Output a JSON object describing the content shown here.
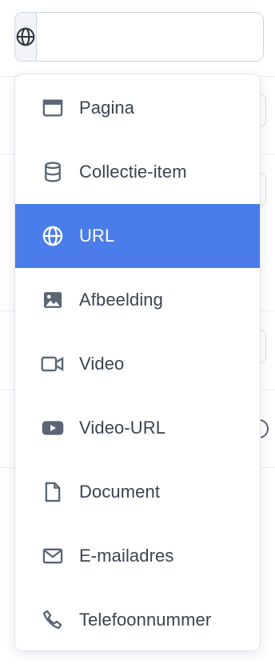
{
  "link_field": {
    "type_button_icon": "globe-icon",
    "url_value": "",
    "url_placeholder": ""
  },
  "menu": {
    "items": [
      {
        "label": "Pagina",
        "icon": "browser-window-icon",
        "active": false
      },
      {
        "label": "Collectie-item",
        "icon": "database-icon",
        "active": false
      },
      {
        "label": "URL",
        "icon": "globe-icon",
        "active": true
      },
      {
        "label": "Afbeelding",
        "icon": "image-icon",
        "active": false
      },
      {
        "label": "Video",
        "icon": "video-camera-icon",
        "active": false
      },
      {
        "label": "Video-URL",
        "icon": "youtube-play-icon",
        "active": false
      },
      {
        "label": "Document",
        "icon": "document-icon",
        "active": false
      },
      {
        "label": "E-mailadres",
        "icon": "envelope-icon",
        "active": false
      },
      {
        "label": "Telefoonnummer",
        "icon": "phone-icon",
        "active": false
      }
    ]
  },
  "colors": {
    "active_background": "#4a7de9",
    "active_text": "#ffffff",
    "text": "#3a4350",
    "icon": "#5b6575",
    "border": "#cfd5de"
  }
}
